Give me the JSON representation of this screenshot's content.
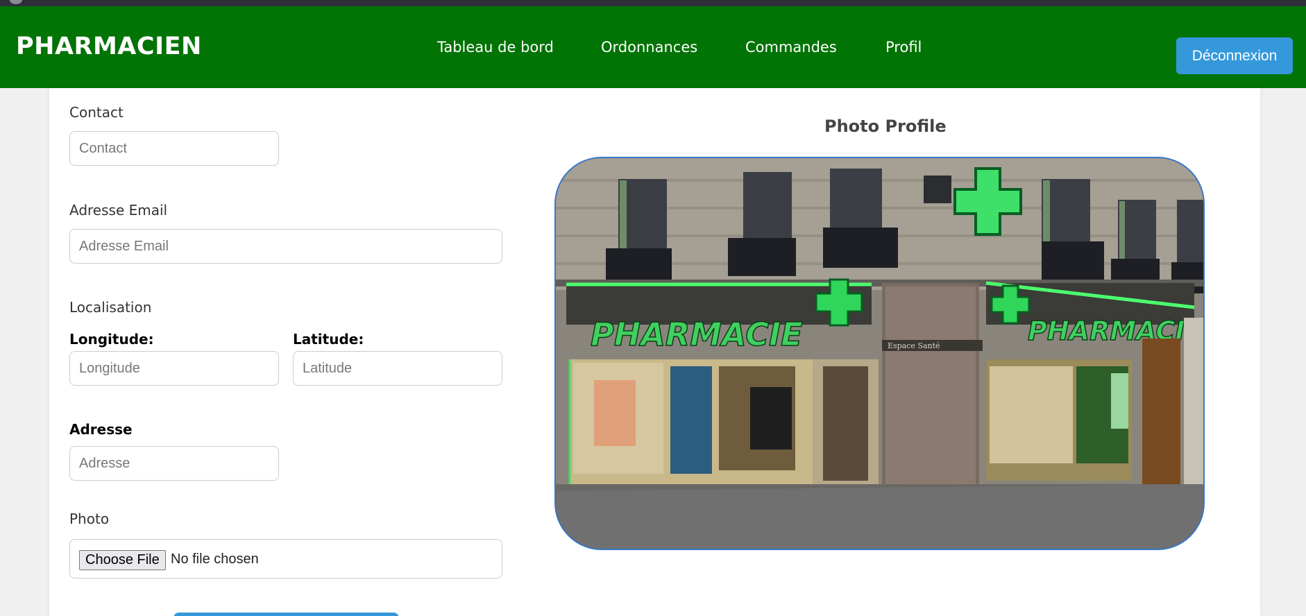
{
  "navbar": {
    "brand": "PHARMACIEN",
    "links": [
      "Tableau de bord",
      "Ordonnances",
      "Commandes",
      "Profil"
    ],
    "logout_label": "Déconnexion",
    "background": "#027305",
    "logout_color": "#3498db"
  },
  "form": {
    "contact": {
      "label": "Contact",
      "placeholder": "Contact",
      "value": ""
    },
    "email": {
      "label": "Adresse Email",
      "placeholder": "Adresse Email",
      "value": ""
    },
    "localisation": {
      "label": "Localisation",
      "longitude_label": "Longitude:",
      "longitude_placeholder": "Longitude",
      "latitude_label": "Latitude:",
      "latitude_placeholder": "Latitude"
    },
    "adresse": {
      "label": "Adresse",
      "placeholder": "Adresse",
      "value": ""
    },
    "photo": {
      "label": "Photo",
      "button_label": "Choose File",
      "status": "No file chosen"
    }
  },
  "profile_photo": {
    "title": "Photo Profile",
    "image_description": "pharmacy storefront with green neon cross",
    "sign_text": "PHARMACIE",
    "plaque_text": "Espace Santé"
  }
}
